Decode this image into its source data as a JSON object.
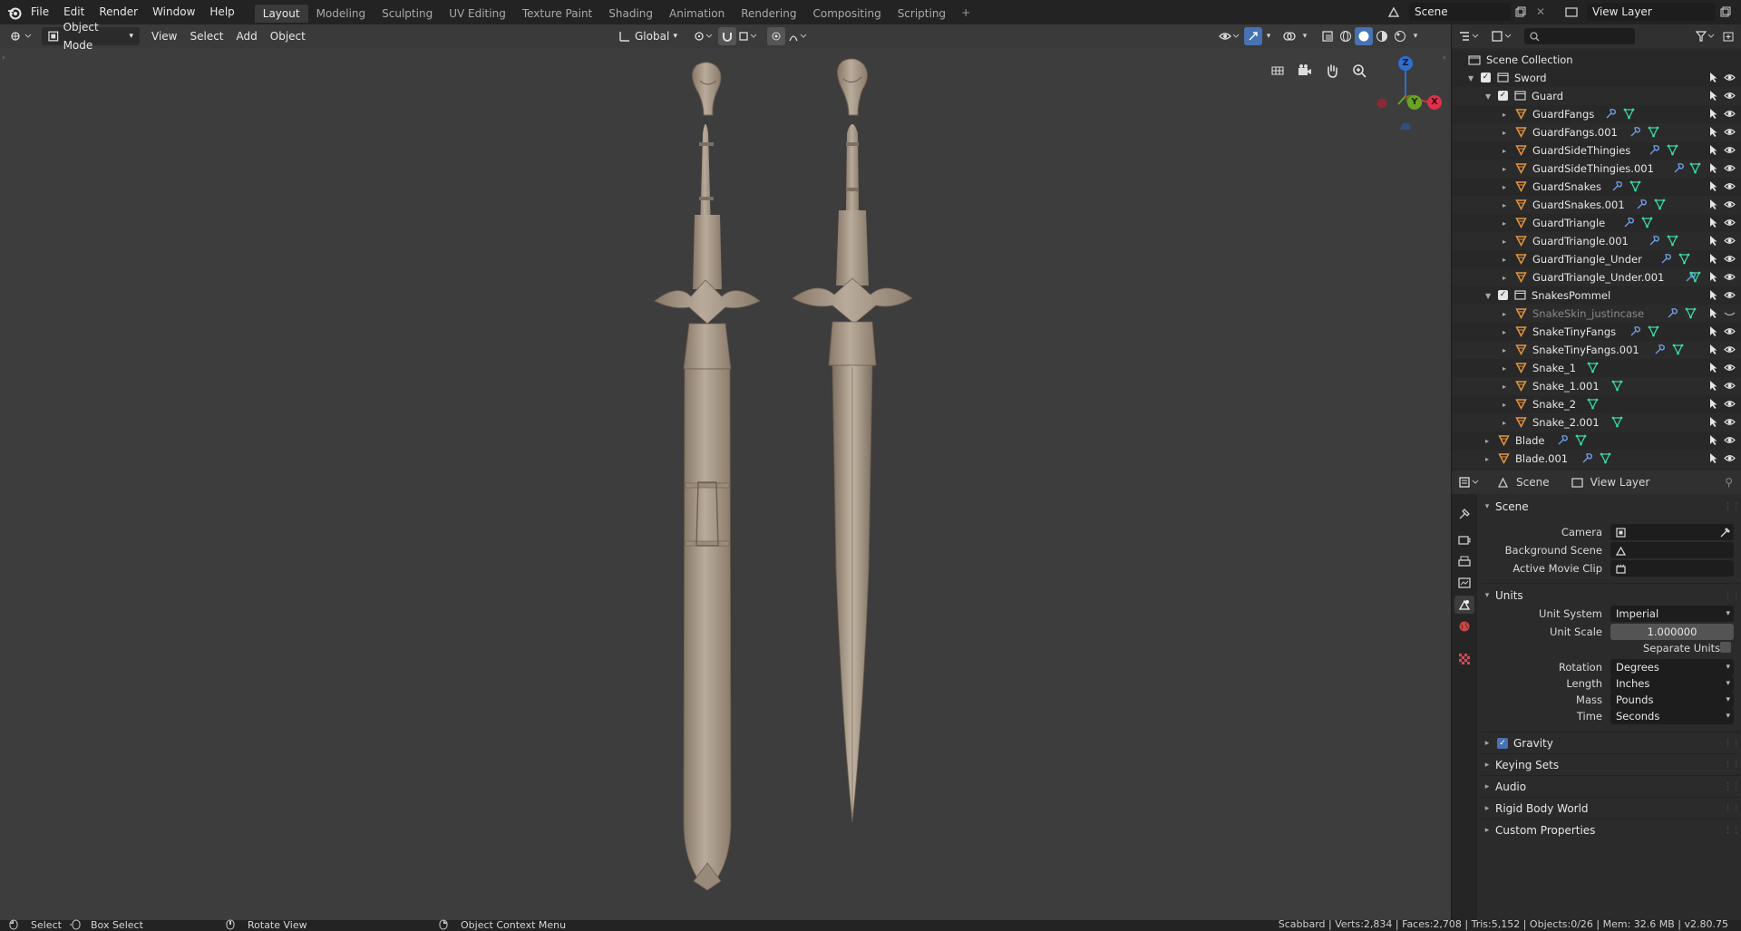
{
  "menu": {
    "file": "File",
    "edit": "Edit",
    "render": "Render",
    "window": "Window",
    "help": "Help"
  },
  "workspaces": [
    "Layout",
    "Modeling",
    "Sculpting",
    "UV Editing",
    "Texture Paint",
    "Shading",
    "Animation",
    "Rendering",
    "Compositing",
    "Scripting"
  ],
  "active_workspace": "Layout",
  "scene_field": "Scene",
  "view_layer_field": "View Layer",
  "viewport": {
    "mode": "Object Mode",
    "menus": {
      "view": "View",
      "select": "Select",
      "add": "Add",
      "object": "Object"
    },
    "transform_orientation": "Global",
    "gizmo_axes": {
      "z": "Z",
      "y": "Y",
      "x": "X"
    }
  },
  "outliner": {
    "root": "Scene Collection",
    "rows": [
      {
        "name": "Sword",
        "level": 1,
        "type": "collection",
        "checked": true,
        "expanded": true
      },
      {
        "name": "Guard",
        "level": 2,
        "type": "collection",
        "checked": true,
        "expanded": true
      },
      {
        "name": "GuardFangs",
        "level": 3,
        "type": "mesh",
        "wrench": true
      },
      {
        "name": "GuardFangs.001",
        "level": 3,
        "type": "mesh",
        "wrench": true
      },
      {
        "name": "GuardSideThingies",
        "level": 3,
        "type": "mesh",
        "wrench": true
      },
      {
        "name": "GuardSideThingies.001",
        "level": 3,
        "type": "mesh",
        "wrench": true
      },
      {
        "name": "GuardSnakes",
        "level": 3,
        "type": "mesh",
        "wrench": true
      },
      {
        "name": "GuardSnakes.001",
        "level": 3,
        "type": "mesh",
        "wrench": true
      },
      {
        "name": "GuardTriangle",
        "level": 3,
        "type": "mesh",
        "wrench": true
      },
      {
        "name": "GuardTriangle.001",
        "level": 3,
        "type": "mesh",
        "wrench": true
      },
      {
        "name": "GuardTriangle_Under",
        "level": 3,
        "type": "mesh",
        "wrench": true
      },
      {
        "name": "GuardTriangle_Under.001",
        "level": 3,
        "type": "mesh",
        "wrench": true
      },
      {
        "name": "SnakesPommel",
        "level": 2,
        "type": "collection",
        "checked": true,
        "expanded": true
      },
      {
        "name": "SnakeSkin_justincase",
        "level": 3,
        "type": "mesh",
        "wrench": true,
        "dim": true
      },
      {
        "name": "SnakeTinyFangs",
        "level": 3,
        "type": "mesh",
        "wrench": true
      },
      {
        "name": "SnakeTinyFangs.001",
        "level": 3,
        "type": "mesh",
        "wrench": true
      },
      {
        "name": "Snake_1",
        "level": 3,
        "type": "mesh",
        "wrench": false
      },
      {
        "name": "Snake_1.001",
        "level": 3,
        "type": "mesh",
        "wrench": false
      },
      {
        "name": "Snake_2",
        "level": 3,
        "type": "mesh",
        "wrench": false
      },
      {
        "name": "Snake_2.001",
        "level": 3,
        "type": "mesh",
        "wrench": false
      },
      {
        "name": "Blade",
        "level": 2,
        "type": "mesh",
        "wrench": true
      },
      {
        "name": "Blade.001",
        "level": 2,
        "type": "mesh",
        "wrench": true
      }
    ]
  },
  "properties": {
    "header": {
      "scene": "Scene",
      "view_layer": "View Layer"
    },
    "scene_panel": {
      "title": "Scene",
      "camera_label": "Camera",
      "background_scene_label": "Background Scene",
      "active_movie_clip_label": "Active Movie Clip"
    },
    "units_panel": {
      "title": "Units",
      "unit_system_label": "Unit System",
      "unit_system": "Imperial",
      "unit_scale_label": "Unit Scale",
      "unit_scale": "1.000000",
      "separate_units_label": "Separate Units",
      "rotation_label": "Rotation",
      "rotation": "Degrees",
      "length_label": "Length",
      "length": "Inches",
      "mass_label": "Mass",
      "mass": "Pounds",
      "time_label": "Time",
      "time": "Seconds"
    },
    "collapsed_panels": {
      "gravity": "Gravity",
      "keying_sets": "Keying Sets",
      "audio": "Audio",
      "rigid_body_world": "Rigid Body World",
      "custom_properties": "Custom Properties"
    }
  },
  "statusbar": {
    "select": "Select",
    "box_select": "Box Select",
    "rotate_view": "Rotate View",
    "object_context_menu": "Object Context Menu",
    "stats": "Scabbard | Verts:2,834 | Faces:2,708 | Tris:5,152 | Objects:0/26 | Mem: 32.6 MB | v2.80.75"
  },
  "colors": {
    "accent_blue": "#4772b3",
    "mesh_orange": "#e3943f",
    "modifier_blue": "#6f9ce0",
    "vertex_green": "#3cd6a2",
    "sword_clay": "#a99a8a"
  }
}
